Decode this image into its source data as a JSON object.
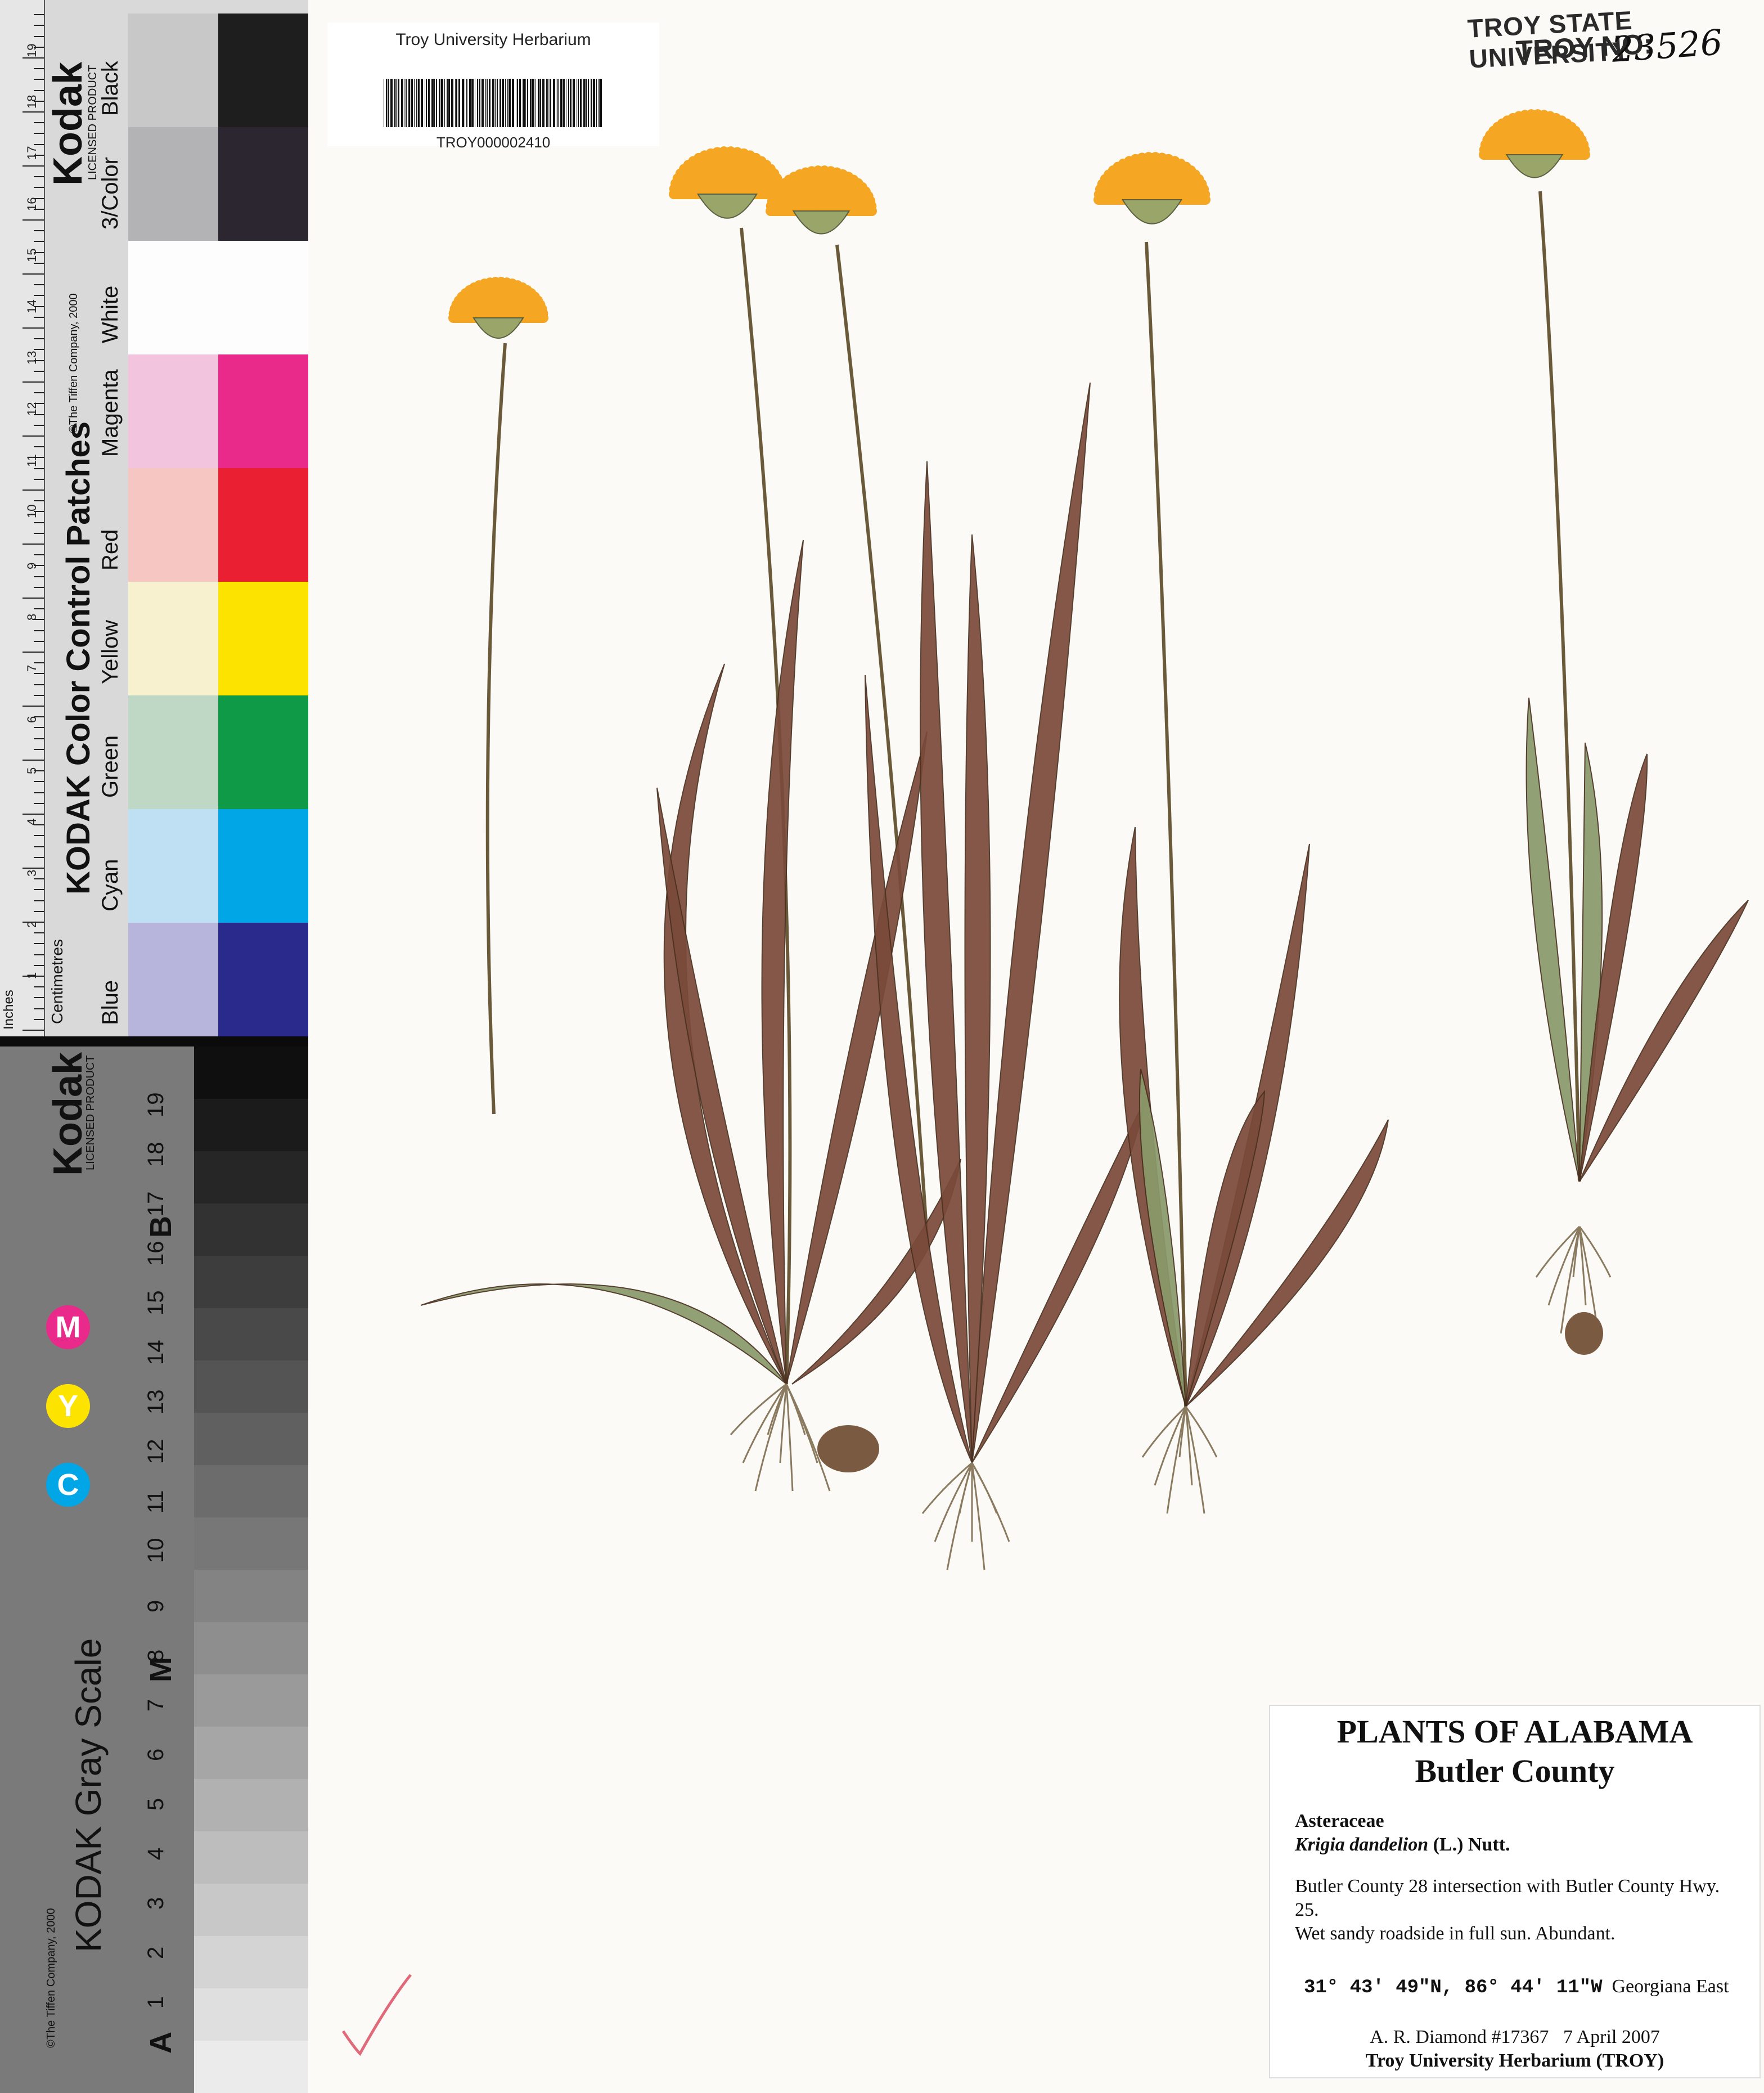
{
  "color_card": {
    "brand": "Kodak",
    "licensed": "LICENSED PRODUCT",
    "title": "KODAK Color Control Patches",
    "copyright": "©The Tiffen Company, 2000",
    "ruler_units_top": "Centimetres",
    "ruler_units_left": "Inches",
    "patches": [
      {
        "label": "Blue",
        "light": "#b7b5dc",
        "dark": "#2a2a8c"
      },
      {
        "label": "Cyan",
        "light": "#bfe0f3",
        "dark": "#00a6e6"
      },
      {
        "label": "Green",
        "light": "#bfd8c6",
        "dark": "#0f9a48"
      },
      {
        "label": "Yellow",
        "light": "#f7f1cf",
        "dark": "#fde400"
      },
      {
        "label": "Red",
        "light": "#f6c6c2",
        "dark": "#ea1f32"
      },
      {
        "label": "Magenta",
        "light": "#f2c4dd",
        "dark": "#ea2a8a"
      },
      {
        "label": "White",
        "light": "#fdfdfd",
        "dark": "#fdfdfd"
      },
      {
        "label": "3/Color",
        "light": "#b3b3b5",
        "dark": "#2b2630"
      },
      {
        "label": "Black",
        "light": "#c8c8c8",
        "dark": "#1e1e1e"
      }
    ],
    "cm_numbers": [
      "1",
      "2",
      "3",
      "4",
      "5",
      "6",
      "7",
      "8",
      "9",
      "10",
      "11",
      "12",
      "13",
      "14",
      "15",
      "16",
      "17",
      "18",
      "19"
    ]
  },
  "gray_card": {
    "brand": "Kodak",
    "licensed": "LICENSED PRODUCT",
    "title": "KODAK Gray Scale",
    "copyright": "©The Tiffen Company, 2000",
    "cmy": [
      "C",
      "Y",
      "M"
    ],
    "cmy_colors": [
      "#00a6e6",
      "#fde400",
      "#ea2a8a"
    ],
    "markers": [
      "A",
      "M",
      "B"
    ],
    "numbers": [
      "1",
      "2",
      "3",
      "4",
      "5",
      "6",
      "7",
      "8",
      "9",
      "10",
      "11",
      "12",
      "13",
      "14",
      "15",
      "16",
      "17",
      "18",
      "19"
    ]
  },
  "barcode": {
    "title": "Troy University Herbarium",
    "id": "TROY000002410"
  },
  "stamp": {
    "line1": "TROY STATE UNIVERSITY",
    "line2": "TROY NO:",
    "number": "23526"
  },
  "label": {
    "title": "PLANTS OF ALABAMA",
    "county": "Butler County",
    "family": "Asteraceae",
    "species_name": "Krigia dandelion",
    "species_author": "(L.) Nutt.",
    "locality": "Butler County 28 intersection with Butler County Hwy. 25.",
    "habitat": "Wet sandy roadside in full sun. Abundant.",
    "coordinates": "31° 43' 49\"N, 86° 44' 11\"W",
    "place": "Georgiana East",
    "collector": "A. R. Diamond #17367",
    "date": "7 April 2007",
    "herbarium": "Troy University Herbarium (TROY)"
  },
  "colors": {
    "flower": "#f5a623",
    "leaf": "#7a4a3a",
    "leaf_green": "#8a9a6a",
    "stem": "#6b5a3a"
  }
}
